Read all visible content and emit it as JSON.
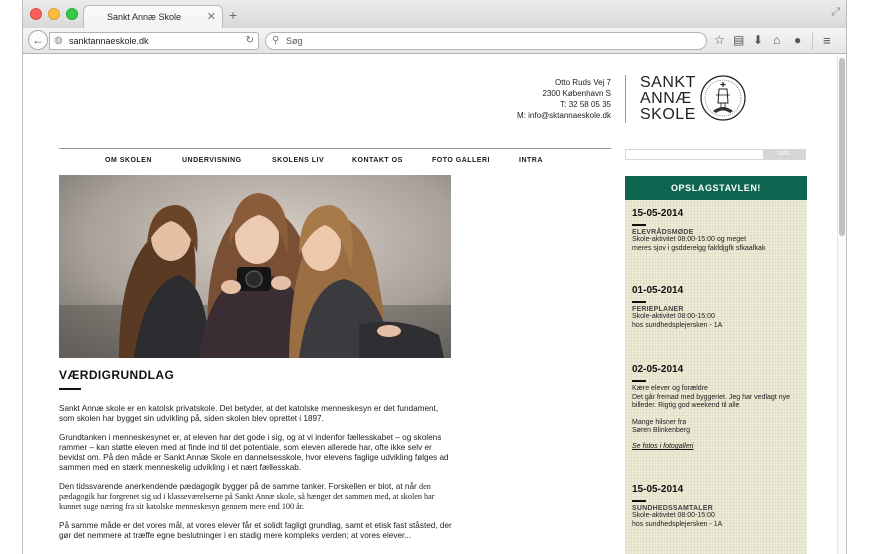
{
  "browser": {
    "tab_title": "Sankt Annæ Skole",
    "url": "sanktannaeskole.dk",
    "search_placeholder": "Søg"
  },
  "header": {
    "address_lines": [
      "Otto Ruds Vej 7",
      "2300 København S",
      "T:  32 58 05 35",
      "M: info@sktannaeskole.dk"
    ],
    "logo_lines": [
      "SANKT",
      "ANNÆ",
      "SKOLE"
    ]
  },
  "nav": {
    "items": [
      "OM SKOLEN",
      "UNDERVISNING",
      "SKOLENS LIV",
      "KONTAKT OS",
      "FOTO GALLERI",
      "INTRA"
    ]
  },
  "site_search": {
    "button": "SØG"
  },
  "article": {
    "title": "VÆRDIGRUNDLAG",
    "p1": "Sankt Annæ skole er en katolsk privatskole. Det betyder, at det katolske menneskesyn er det fundament, som skolen har bygget sin udvikling på, siden skolen blev oprettet i 1897.",
    "p2": "Grundtanken i menneskesynet er, at eleven har det gode i sig, og at vi indenfor fællesskabet – og skolens rammer – kan støtte eleven med at finde ind til det potentiale, som eleven allerede har, ofte ikke selv er bevidst om. På den måde er Sankt Annæ Skole en dannelsesskole, hvor elevens faglige udvikling følges ad sammen med en stærk menneskelig udvikling i et nært fællesskab.",
    "p3a": "Den tidssvarende anerkendende pædagogik bygger på de samme tanker.  Forskellen er blot, at når",
    "p3b": "den pædagogik har forgrenet sig ud i klasseværelserne på Sankt Annæ skole, så hænger det sammen med, at skolen har kunnet suge næring fra sit katolske menneskesyn gennem mere end 100 år.",
    "p4": "På samme måde er det vores mål, at vores elever får et solidt fagligt grundlag, samt et etisk fast ståsted, der gør det nemmere at træffe egne beslutninger i en stadig mere kompleks verden; at vores elever..."
  },
  "board": {
    "title": "OPSLAGSTAVLEN!",
    "entries": [
      {
        "date": "15-05-2014",
        "heading": "ELEVRÅDSMØDE",
        "lines": [
          "Skole-aktivitet 08:00-15:00  og meget",
          "meres sjov i gsdderelgg  fakfdjgfk sfkaafkak"
        ]
      },
      {
        "date": "01-05-2014",
        "heading": "FERIEPLANER",
        "lines": [
          "Skole-aktivitet 08:00-15:00",
          "hos sundhedsplejersken - 1A"
        ]
      },
      {
        "date": "02-05-2014",
        "lines": [
          "Kære elever og forældre",
          "Det går fremad med byggeriet. Jeg har vedlagt nye",
          "billeder. Rigtig god weekend til alle"
        ],
        "sign": [
          "Mange hilsner fra",
          "Søren Blinkenberg"
        ],
        "link": "Se fotos i fotogalleri"
      },
      {
        "date": "15-05-2014",
        "heading": "SUNDHEDSSAMTALER",
        "lines": [
          "Skole-aktivitet 08:00-15:00",
          "hos sundhedsplejersken - 1A"
        ]
      }
    ]
  },
  "colors": {
    "board_header": "#0e6650",
    "board_bg": "#ecebd4"
  }
}
